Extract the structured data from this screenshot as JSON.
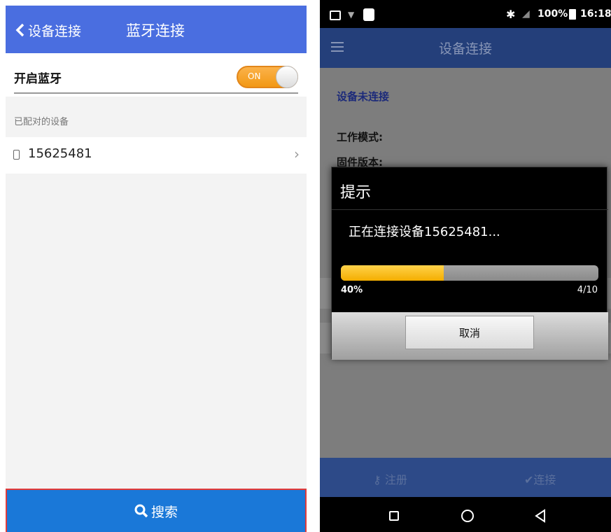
{
  "left": {
    "header": {
      "back_label": "设备连接",
      "title": "蓝牙连接"
    },
    "bluetooth": {
      "label": "开启蓝牙",
      "toggle_text": "ON"
    },
    "paired_section_title": "已配对的设备",
    "paired_devices": [
      {
        "name": "15625481"
      }
    ],
    "search_button": "搜索",
    "colors": {
      "header": "#4a6ee0",
      "search": "#1a78d8",
      "toggle": "#f29814"
    }
  },
  "right": {
    "statusbar": {
      "battery": "100%",
      "time": "16:18"
    },
    "appbar": {
      "title": "设备连接"
    },
    "content": {
      "status": "设备未连接",
      "fields": [
        "工作模式:",
        "固件版本:"
      ]
    },
    "dialog": {
      "title": "提示",
      "message": "正在连接设备15625481...",
      "progress_percent_label": "40%",
      "progress_fraction": 0.4,
      "progress_count": "4/10",
      "cancel_label": "取消"
    },
    "bottombar": {
      "register_label": "注册",
      "connect_label": "连接"
    }
  }
}
